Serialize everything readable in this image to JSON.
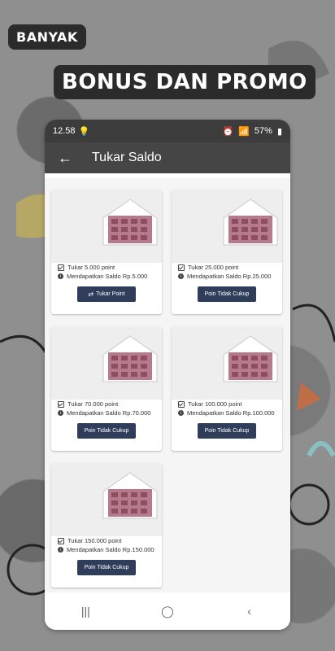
{
  "promo": {
    "small": "BANYAK",
    "big": "BONUS DAN PROMO"
  },
  "status_bar": {
    "time": "12.58",
    "battery": "57%"
  },
  "appbar": {
    "title": "Tukar Saldo"
  },
  "cards": [
    {
      "point": "Tukar 5.000 point",
      "saldo": "Mendapatkan Saldo Rp.5.000",
      "button": "Tukar Point"
    },
    {
      "point": "Tukar 25.000 point",
      "saldo": "Mendapatkan Saldo Rp.25.000",
      "button": "Poin Tidak Cukup"
    },
    {
      "point": "Tukar 70.000 point",
      "saldo": "Mendapatkan Saldo Rp.70.000",
      "button": "Poin Tidak Cukup"
    },
    {
      "point": "Tukar 100.000 point",
      "saldo": "Mendapatkan Saldo Rp.100.000",
      "button": "Poin Tidak Cukup"
    },
    {
      "point": "Tukar 150.000 point",
      "saldo": "Mendapatkan Saldo Rp.150.000",
      "button": "Poin Tidak Cukup"
    }
  ]
}
